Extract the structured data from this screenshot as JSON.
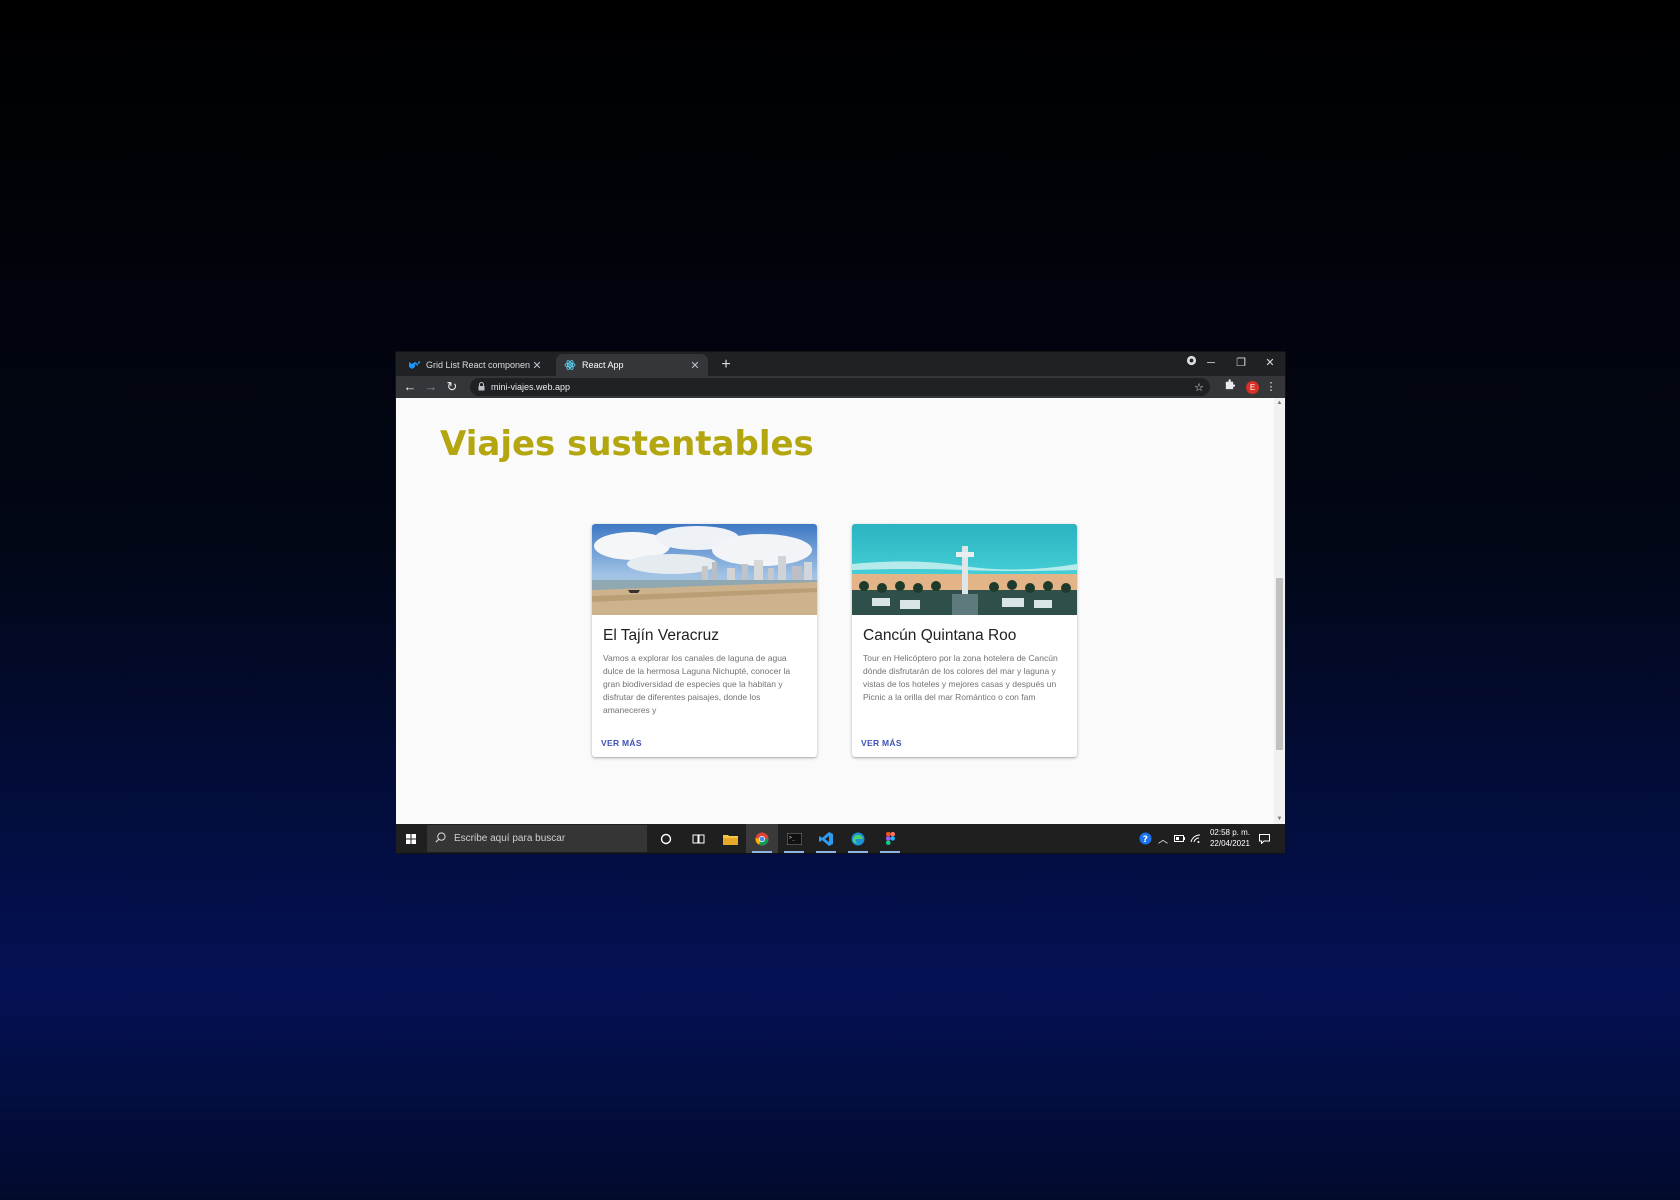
{
  "browser": {
    "tabs": [
      {
        "title": "Grid List React component - Mat",
        "active": false
      },
      {
        "title": "React App",
        "active": true
      }
    ],
    "url": "mini-viajes.web.app",
    "profile_initial": "E"
  },
  "page": {
    "heading": "Viajes sustentables",
    "cards": [
      {
        "title": "El Tajín Veracruz",
        "description": "Vamos a explorar los canales de laguna de agua dulce de la hermosa Laguna Nichupté, conocer la gran biodiversidad de especies que la habitan y disfrutar de diferentes paisajes, donde los amaneceres y",
        "action": "VER MÁS"
      },
      {
        "title": "Cancún Quintana Roo",
        "description": "Tour en Helicóptero por la zona hotelera de Cancún dónde disfrutarán de los colores del mar y laguna y vistas de los hoteles y mejores casas y después un Picnic a la orilla del mar Romántico o con fam",
        "action": "VER MÁS"
      }
    ],
    "accent_color": "#b3a60f",
    "link_color": "#3f51b5"
  },
  "taskbar": {
    "search_placeholder": "Escribe aquí para buscar",
    "time": "02:58 p. m.",
    "date": "22/04/2021"
  }
}
